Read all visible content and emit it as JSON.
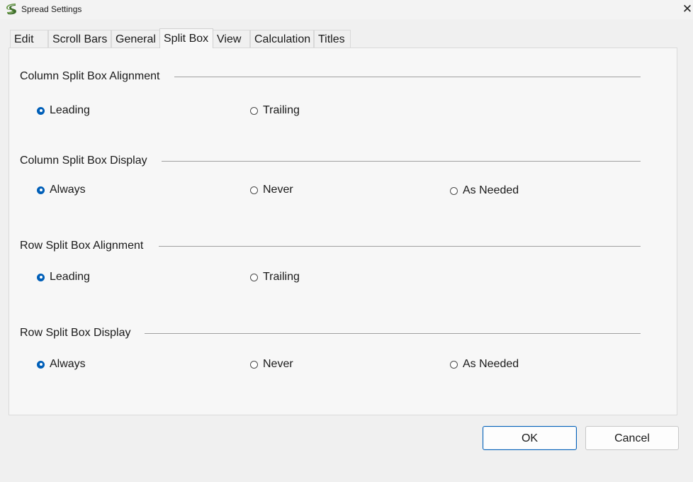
{
  "window": {
    "title": "Spread Settings",
    "close_symbol": "✕"
  },
  "tabs": [
    {
      "label": "Edit"
    },
    {
      "label": "Scroll Bars"
    },
    {
      "label": "General"
    },
    {
      "label": "Split Box",
      "selected": true
    },
    {
      "label": "View"
    },
    {
      "label": "Calculation"
    },
    {
      "label": "Titles"
    }
  ],
  "groups": {
    "column_alignment": {
      "title": "Column Split Box Alignment",
      "options": [
        {
          "label": "Leading",
          "checked": true
        },
        {
          "label": "Trailing",
          "checked": false
        }
      ]
    },
    "column_display": {
      "title": "Column Split Box Display",
      "options": [
        {
          "label": "Always",
          "checked": true
        },
        {
          "label": "Never",
          "checked": false
        },
        {
          "label": "As Needed",
          "checked": false
        }
      ]
    },
    "row_alignment": {
      "title": "Row Split Box Alignment",
      "options": [
        {
          "label": "Leading",
          "checked": true
        },
        {
          "label": "Trailing",
          "checked": false
        }
      ]
    },
    "row_display": {
      "title": "Row Split Box Display",
      "options": [
        {
          "label": "Always",
          "checked": true
        },
        {
          "label": "Never",
          "checked": false
        },
        {
          "label": "As Needed",
          "checked": false
        }
      ]
    }
  },
  "buttons": {
    "ok_label": "OK",
    "cancel_label": "Cancel"
  },
  "colors": {
    "accent": "#005fb8",
    "background": "#f0f0f0",
    "panel": "#f7f7f7"
  }
}
